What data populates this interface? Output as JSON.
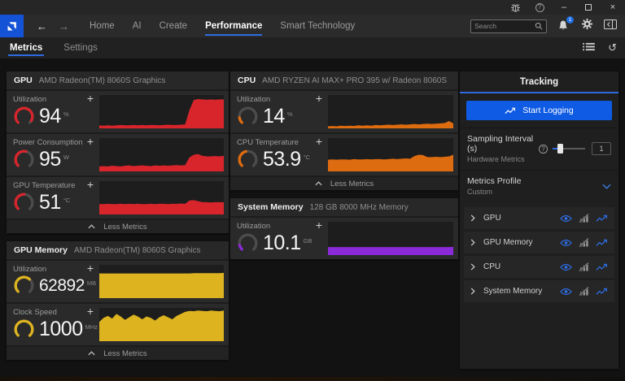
{
  "icons": {
    "plus": "+",
    "minimize": "–",
    "close": "×",
    "back": "←",
    "forward": "→",
    "reset": "↺",
    "help": "?",
    "chevron_up": "icon",
    "chevron_down": "icon",
    "chevron_right": "icon",
    "bug_report": "icon",
    "maximize": "icon",
    "bell": "icon",
    "gear": "icon",
    "panel_toggle": "icon",
    "search": "icon",
    "list_view": "icon",
    "eye": "icon",
    "histogram_disabled": "icon",
    "line_graph": "icon",
    "amd_logo": "icon"
  },
  "colors": {
    "accent_blue": "#2e6be0",
    "button_blue": "#0f5be4",
    "gpu_red": "#d8252c",
    "cpu_orange": "#dd6b10",
    "memory_gold": "#ddb31f",
    "system_purple": "#8a2ad8"
  },
  "nav": {
    "items": [
      {
        "label": "Home"
      },
      {
        "label": "AI"
      },
      {
        "label": "Create"
      },
      {
        "label": "Performance"
      },
      {
        "label": "Smart Technology"
      }
    ],
    "search_placeholder": "Search",
    "notification_count": "1"
  },
  "tabs": {
    "metrics": "Metrics",
    "settings": "Settings"
  },
  "labels": {
    "less_metrics": "Less Metrics"
  },
  "sections": {
    "gpu": {
      "title": "GPU",
      "subtitle": "AMD Radeon(TM) 8060S Graphics",
      "tiles": [
        {
          "label": "Utilization",
          "value": "94",
          "unit": "%",
          "gauge": 0.94,
          "color": "#d8252c",
          "chart": "gpu_utilization"
        },
        {
          "label": "Power Consumption",
          "value": "95",
          "unit": "W",
          "gauge": 0.55,
          "color": "#d8252c",
          "chart": "gpu_power"
        },
        {
          "label": "GPU Temperature",
          "value": "51",
          "unit": "°C",
          "gauge": 0.5,
          "color": "#d8252c",
          "chart": "gpu_temperature"
        }
      ]
    },
    "gpu_memory": {
      "title": "GPU Memory",
      "subtitle": "AMD Radeon(TM) 8060S Graphics",
      "tiles": [
        {
          "label": "Utilization",
          "value": "62892",
          "unit": "MB",
          "gauge": 0.65,
          "color": "#ddb31f",
          "chart": "gpu_memory_utilization"
        },
        {
          "label": "Clock Speed",
          "value": "1000",
          "unit": "MHz",
          "gauge": 1.0,
          "color": "#ddb31f",
          "chart": "gpu_memory_clock"
        }
      ]
    },
    "cpu": {
      "title": "CPU",
      "subtitle": "AMD RYZEN AI MAX+ PRO 395 w/ Radeon 8060S",
      "tiles": [
        {
          "label": "Utilization",
          "value": "14",
          "unit": "%",
          "gauge": 0.14,
          "color": "#dd6b10",
          "chart": "cpu_utilization"
        },
        {
          "label": "CPU Temperature",
          "value": "53.9",
          "unit": "°C",
          "gauge": 0.45,
          "color": "#dd6b10",
          "chart": "cpu_temperature"
        }
      ]
    },
    "system_memory": {
      "title": "System Memory",
      "subtitle": "128 GB 8000 MHz Memory",
      "tiles": [
        {
          "label": "Utilization",
          "value": "10.1",
          "unit": "GB",
          "gauge": 0.12,
          "color": "#8a2ad8",
          "chart": "system_memory_utilization"
        }
      ]
    }
  },
  "tracking": {
    "title": "Tracking",
    "start_logging": "Start Logging",
    "sampling_interval_label": "Sampling Interval (s)",
    "sampling_interval_sub": "Hardware Metrics",
    "sampling_interval_value": "1",
    "metrics_profile_label": "Metrics Profile",
    "metrics_profile_value": "Custom",
    "rows": [
      {
        "label": "GPU"
      },
      {
        "label": "GPU Memory"
      },
      {
        "label": "CPU"
      },
      {
        "label": "System Memory"
      }
    ]
  },
  "chart_data": {
    "type": "area-sparklines",
    "note": "values are percent of chart height, left to right over time",
    "gpu_utilization": {
      "color": "#d8252c",
      "values": [
        9,
        8,
        9,
        8,
        9,
        10,
        9,
        9,
        10,
        9,
        10,
        9,
        10,
        10,
        9,
        10,
        11,
        10,
        10,
        11,
        12,
        55,
        85,
        88,
        87,
        86,
        87,
        86,
        87,
        87
      ]
    },
    "gpu_power": {
      "color": "#d8252c",
      "values": [
        15,
        16,
        15,
        17,
        16,
        15,
        17,
        18,
        16,
        17,
        18,
        17,
        16,
        18,
        17,
        18,
        17,
        18,
        19,
        18,
        19,
        42,
        50,
        52,
        47,
        45,
        45,
        46,
        45,
        47
      ]
    },
    "gpu_temperature": {
      "color": "#d8252c",
      "values": [
        31,
        31,
        32,
        31,
        31,
        32,
        31,
        32,
        31,
        32,
        31,
        31,
        32,
        31,
        32,
        32,
        31,
        32,
        32,
        33,
        32,
        42,
        43,
        40,
        37,
        37,
        36,
        37,
        37,
        37
      ]
    },
    "gpu_memory_utilization": {
      "color": "#ddb31f",
      "values": [
        74,
        74,
        74,
        74,
        74,
        74,
        74,
        74,
        74,
        74,
        74,
        74,
        74,
        74,
        74,
        74,
        74,
        74,
        74,
        74,
        74,
        74,
        75,
        75,
        75,
        75,
        75,
        75,
        75,
        76
      ]
    },
    "gpu_memory_clock": {
      "color": "#ddb31f",
      "values": [
        58,
        70,
        76,
        68,
        82,
        74,
        64,
        72,
        80,
        74,
        66,
        74,
        70,
        62,
        72,
        78,
        72,
        66,
        76,
        82,
        88,
        91,
        90,
        92,
        91,
        90,
        92,
        91,
        90,
        92
      ]
    },
    "cpu_utilization": {
      "color": "#dd6b10",
      "values": [
        6,
        7,
        6,
        8,
        7,
        8,
        7,
        9,
        8,
        9,
        8,
        10,
        9,
        10,
        11,
        10,
        11,
        12,
        11,
        12,
        13,
        12,
        13,
        14,
        13,
        14,
        15,
        16,
        22,
        15
      ]
    },
    "cpu_temperature": {
      "color": "#dd6b10",
      "values": [
        35,
        36,
        35,
        36,
        36,
        35,
        37,
        36,
        36,
        37,
        36,
        37,
        37,
        36,
        37,
        38,
        37,
        38,
        39,
        38,
        46,
        50,
        49,
        43,
        43,
        44,
        43,
        44,
        45,
        50
      ]
    },
    "system_memory_utilization": {
      "color": "#8a2ad8",
      "values": [
        24,
        24,
        24,
        24,
        24,
        24,
        24,
        24,
        24,
        24,
        24,
        24,
        24,
        24,
        24,
        24,
        24,
        24,
        24,
        24,
        24,
        24,
        24,
        24,
        24,
        24,
        24,
        24,
        24,
        25
      ]
    }
  }
}
